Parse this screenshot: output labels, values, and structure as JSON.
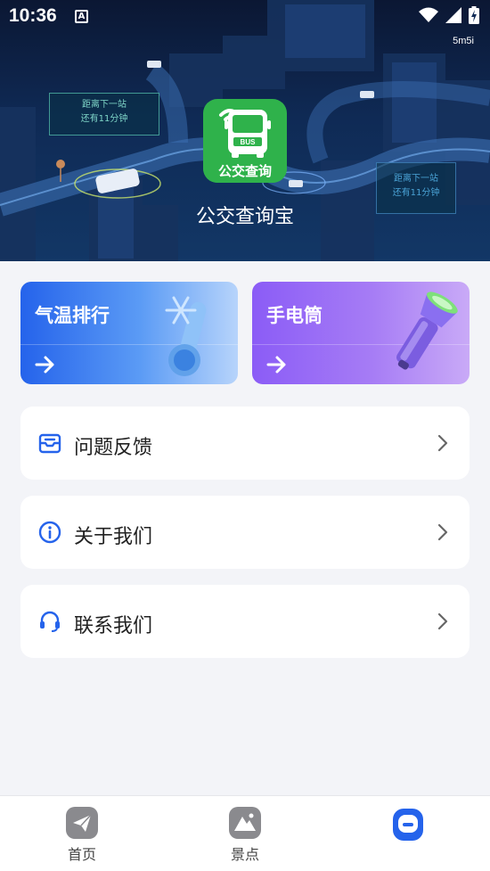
{
  "status_bar": {
    "time": "10:36",
    "a_icon": "A",
    "icons": [
      "wifi-icon",
      "signal-icon",
      "battery-charging-icon"
    ]
  },
  "watermark": "5m5i",
  "banner": {
    "sign_left_line1": "距离下一站",
    "sign_left_line2": "还有11分钟",
    "sign_right_line1": "距离下一站",
    "sign_right_line2": "还有11分钟",
    "logo_bus_text": "BUS",
    "logo_caption": "公交查询",
    "app_name": "公交查询宝"
  },
  "cards": {
    "weather": {
      "title": "气温排行",
      "icon": "thermometer-snowflake-icon"
    },
    "torch": {
      "title": "手电筒",
      "icon": "flashlight-icon"
    }
  },
  "menu": {
    "feedback": "问题反馈",
    "about": "关于我们",
    "contact": "联系我们"
  },
  "bottom_nav": {
    "home": "首页",
    "scenic": "景点",
    "active": "mine"
  },
  "colors": {
    "accent": "#2563eb",
    "logo_green": "#2fb24b",
    "card_blue": "#2563eb",
    "card_purple": "#8b5cf6",
    "background": "#f3f4f8"
  }
}
